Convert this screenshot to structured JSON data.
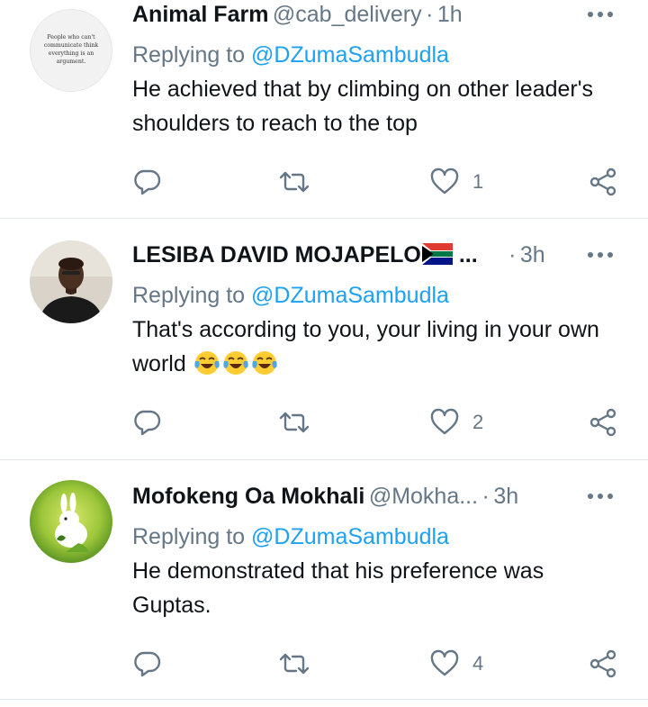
{
  "tweets": [
    {
      "name": "Animal Farm",
      "handle": "@cab_delivery",
      "time": "1h",
      "replying_prefix": "Replying to",
      "replying_to": "@DZumaSambudla",
      "text": "He achieved that by climbing on other leader's shoulders to reach to the top",
      "likes": "1",
      "avatar_text": [
        "People who can't",
        "communicate think",
        "everything is an",
        "argument."
      ]
    },
    {
      "name": "LESIBA DAVID MOJAPELO",
      "name_suffix": " ...",
      "handle": "",
      "time": "3h",
      "replying_prefix": "Replying to",
      "replying_to": "@DZumaSambudla",
      "text": "That's according to you, your living in your own world",
      "likes": "2",
      "emoji": "face-with-tears-of-joy",
      "flag": "south-africa-flag"
    },
    {
      "name": "Mofokeng Oa Mokhali",
      "handle": "@Mokha...",
      "time": "3h",
      "replying_prefix": "Replying to",
      "replying_to": "@DZumaSambudla",
      "text": "He demonstrated that his preference was Guptas.",
      "likes": "4"
    }
  ],
  "separator": "·",
  "icons": {
    "reply": "reply-icon",
    "retweet": "retweet-icon",
    "like": "heart-icon",
    "share": "share-icon",
    "more": "more-icon"
  },
  "colors": {
    "text": "#0f1419",
    "secondary": "#657786",
    "mention": "#1da1f2",
    "divider": "#e1e8ed"
  }
}
